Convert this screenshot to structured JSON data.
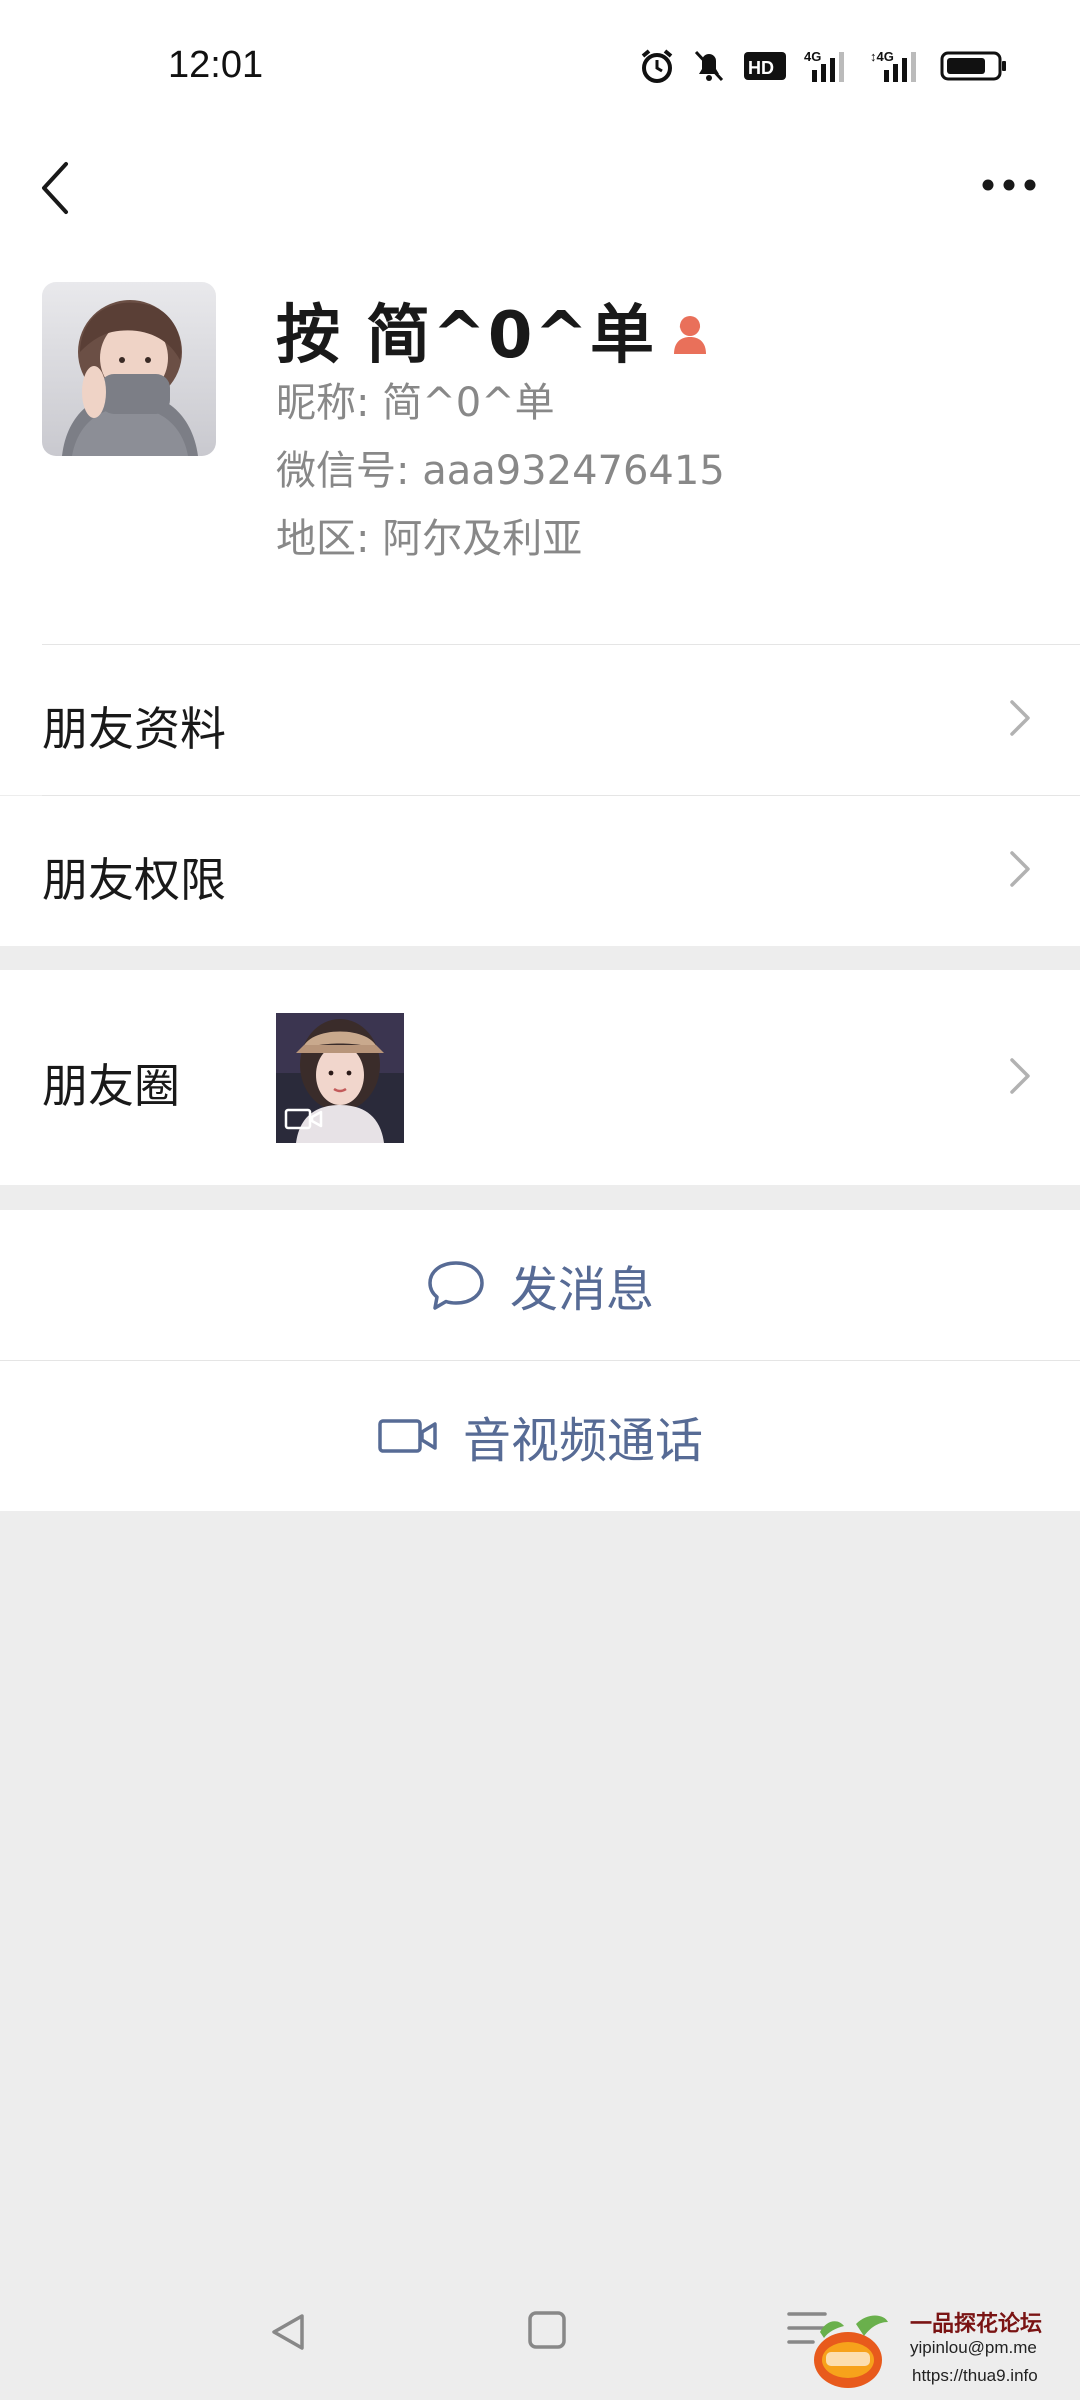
{
  "status_bar": {
    "time": "12:01",
    "icons": [
      "alarm-icon",
      "mute-bell-icon",
      "hd-icon",
      "signal-4g-icon",
      "signal-4g-icon",
      "battery-icon"
    ]
  },
  "header": {
    "back_icon": "chevron-left-icon",
    "more_icon": "more-dots-icon"
  },
  "profile": {
    "display_name": "按 简^0^单",
    "gender_icon": "female-icon",
    "nickname": "昵称:  简^0^单",
    "wechat_id": "微信号:  aaa932476415",
    "region": "地区:  阿尔及利亚"
  },
  "rows": {
    "friend_profile": "朋友资料",
    "friend_permissions": "朋友权限",
    "moments": "朋友圈"
  },
  "actions": {
    "send_message": "发消息",
    "av_call": "音视频通话"
  },
  "watermark": {
    "title": "一品探花论坛",
    "email": "yipinlou@pm.me",
    "url": "https://thua9.info"
  },
  "colors": {
    "accent_link": "#576b95",
    "background": "#ededed",
    "female_icon": "#e9705a"
  }
}
